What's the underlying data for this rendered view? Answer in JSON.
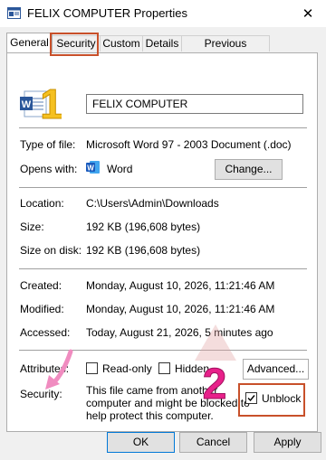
{
  "window": {
    "title": "FELIX COMPUTER Properties",
    "close_glyph": "✕"
  },
  "tabs": [
    {
      "label": "General",
      "active": true
    },
    {
      "label": "Security",
      "active": false
    },
    {
      "label": "Custom",
      "active": false
    },
    {
      "label": "Details",
      "active": false
    },
    {
      "label": "Previous Versions",
      "active": false
    }
  ],
  "file": {
    "name": "FELIX COMPUTER",
    "icon": "word-document-icon"
  },
  "info": {
    "type_label": "Type of file:",
    "type_value": "Microsoft Word 97 - 2003 Document (.doc)",
    "opens_label": "Opens with:",
    "opens_value": "Word",
    "change_label": "Change...",
    "location_label": "Location:",
    "location_value": "C:\\Users\\Admin\\Downloads",
    "size_label": "Size:",
    "size_value": "192 KB (196,608 bytes)",
    "size_on_disk_label": "Size on disk:",
    "size_on_disk_value": "192 KB (196,608 bytes)",
    "created_label": "Created:",
    "created_value": "Monday, August 10, 2026, 11:21:46 AM",
    "modified_label": "Modified:",
    "modified_value": "Monday, August 10, 2026, 11:21:46 AM",
    "accessed_label": "Accessed:",
    "accessed_value": "Today, August 21, 2026, 5 minutes ago"
  },
  "attributes": {
    "label": "Attributes:",
    "readonly_label": "Read-only",
    "hidden_label": "Hidden",
    "advanced_label": "Advanced...",
    "readonly_checked": false,
    "hidden_checked": false
  },
  "security": {
    "label": "Security:",
    "line1": "This file came from another",
    "line2": "computer and might be blocked to",
    "line3": "help protect this computer.",
    "unblock_label": "Unblock",
    "unblock_checked": true
  },
  "buttons": {
    "ok": "OK",
    "cancel": "Cancel",
    "apply": "Apply"
  },
  "annotations": {
    "step1": "1",
    "step2": "2"
  },
  "colors": {
    "highlight": "#c8502a",
    "annotation": "#f5c020",
    "arrow": "#f08cc0",
    "watermark": "#e0a0a0"
  }
}
